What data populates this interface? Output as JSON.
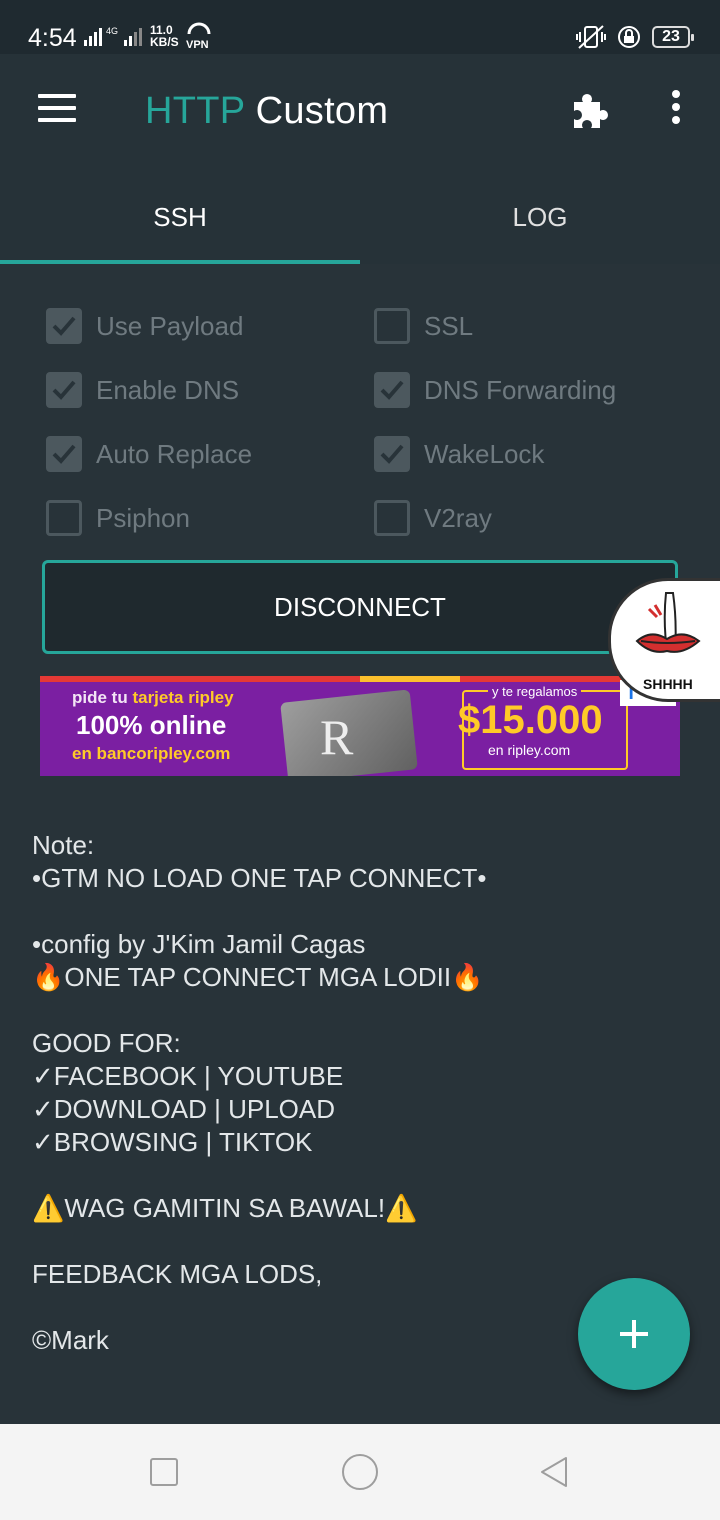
{
  "status_bar": {
    "time": "4:54",
    "net_speed_value": "11.0",
    "net_speed_unit": "KB/S",
    "vpn_label": "VPN",
    "network_type": "4G",
    "battery": "23"
  },
  "app": {
    "title_part1": "HTTP",
    "title_part2": "Custom",
    "accent_color": "#26a69a"
  },
  "tabs": [
    {
      "label": "SSH",
      "active": true
    },
    {
      "label": "LOG",
      "active": false
    }
  ],
  "options": [
    {
      "label": "Use Payload",
      "checked": true
    },
    {
      "label": "SSL",
      "checked": false
    },
    {
      "label": "Enable DNS",
      "checked": true
    },
    {
      "label": "DNS Forwarding",
      "checked": true
    },
    {
      "label": "Auto Replace",
      "checked": true
    },
    {
      "label": "WakeLock",
      "checked": true
    },
    {
      "label": "Psiphon",
      "checked": false
    },
    {
      "label": "V2ray",
      "checked": false
    }
  ],
  "connect_button": "DISCONNECT",
  "ad": {
    "line1_a": "pide tu",
    "line1_b": "tarjeta ripley",
    "line2": "100% online",
    "line3": "en bancoripley.com",
    "card_letter": "R",
    "promo_top": "y te regalamos",
    "promo_amount": "$15.000",
    "promo_site": "en ripley.com",
    "info_icon": "i",
    "close_icon": "✕"
  },
  "sticker_text": "SHHHH",
  "note_lines": [
    "Note:",
    "•GTM NO LOAD ONE TAP CONNECT•",
    "",
    "•config by J'Kim Jamil Cagas",
    "🔥ONE TAP CONNECT MGA LODII🔥",
    "",
    "GOOD FOR:",
    "✓FACEBOOK | YOUTUBE",
    "✓DOWNLOAD | UPLOAD",
    "✓BROWSING | TIKTOK",
    "",
    "⚠️WAG GAMITIN SA BAWAL!⚠️",
    "",
    "FEEDBACK MGA LODS,",
    "",
    "©Mark"
  ],
  "fab_icon": "+"
}
